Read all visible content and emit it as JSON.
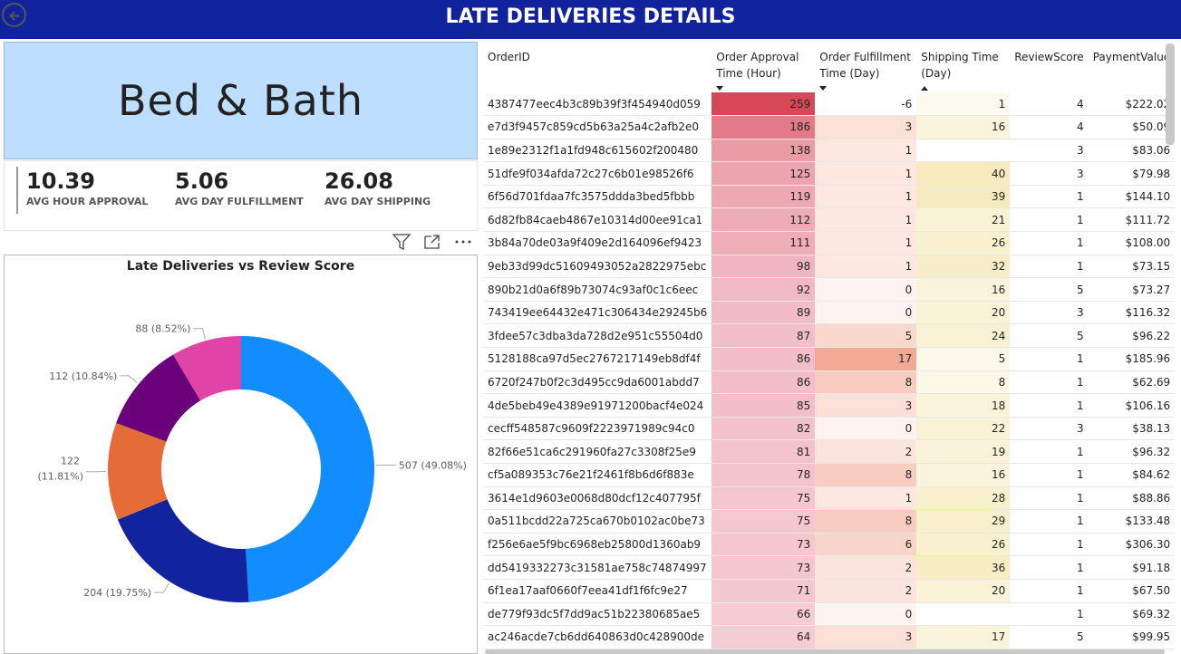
{
  "header": {
    "title": "LATE DELIVERIES DETAILS"
  },
  "category": {
    "name": "Bed & Bath",
    "color": "#bddefe"
  },
  "kpis": [
    {
      "value": "10.39",
      "label": "AVG HOUR APPROVAL"
    },
    {
      "value": "5.06",
      "label": "AVG DAY FULFILLMENT"
    },
    {
      "value": "26.08",
      "label": "AVG DAY SHIPPING"
    }
  ],
  "icons": [
    "filter-icon",
    "focus-mode-icon",
    "more-options-icon"
  ],
  "chart_data": {
    "type": "pie",
    "title": "Late Deliveries vs Review Score",
    "slices": [
      {
        "value": 507,
        "percent": 49.08,
        "label": "507 (49.08%)",
        "color": "#118dff"
      },
      {
        "value": 204,
        "percent": 19.75,
        "label": "204 (19.75%)",
        "color": "#12239e"
      },
      {
        "value": 122,
        "percent": 11.81,
        "label_line1": "122",
        "label_line2": "(11.81%)",
        "color": "#e66c37"
      },
      {
        "value": 112,
        "percent": 10.84,
        "label": "112 (10.84%)",
        "color": "#6b007b"
      },
      {
        "value": 88,
        "percent": 8.52,
        "label": "88 (8.52%)",
        "color": "#e044a7"
      }
    ]
  },
  "table": {
    "columns": [
      {
        "label": "OrderID",
        "sort": ""
      },
      {
        "label": "Order Approval Time (Hour)",
        "sort": "down"
      },
      {
        "label": "Order Fulfillment Time (Day)",
        "sort": "down"
      },
      {
        "label": "Shipping Time (Day)",
        "sort": "up"
      },
      {
        "label": "ReviewScore",
        "sort": ""
      },
      {
        "label": "PaymentValue",
        "sort": ""
      }
    ],
    "rows": [
      [
        "4387477eec4b3c89b39f3f454940d059",
        "259",
        "-6",
        "1",
        "4",
        "$222.02"
      ],
      [
        "e7d3f9457c859cd5b63a25a4c2afb2e0",
        "186",
        "3",
        "16",
        "4",
        "$50.09"
      ],
      [
        "1e89e2312f1a1fd948c615602f200480",
        "138",
        "1",
        "",
        "3",
        "$83.06"
      ],
      [
        "51dfe9f034afda72c27c6b01e98526f6",
        "125",
        "1",
        "40",
        "3",
        "$79.98"
      ],
      [
        "6f56d701fdaa7fc3575ddda3bed5fbbb",
        "119",
        "1",
        "39",
        "1",
        "$144.10"
      ],
      [
        "6d82fb84caeb4867e10314d00ee91ca1",
        "112",
        "1",
        "21",
        "1",
        "$111.72"
      ],
      [
        "3b84a70de03a9f409e2d164096ef9423",
        "111",
        "1",
        "26",
        "1",
        "$108.00"
      ],
      [
        "9eb33d99dc51609493052a2822975ebc",
        "98",
        "1",
        "32",
        "1",
        "$73.15"
      ],
      [
        "890b21d0a6f89b73074c93af0c1c6eec",
        "92",
        "0",
        "16",
        "5",
        "$73.27"
      ],
      [
        "743419ee64432e471c306434e29245b6",
        "89",
        "0",
        "20",
        "3",
        "$116.32"
      ],
      [
        "3fdee57c3dba3da728d2e951c55504d0",
        "87",
        "5",
        "24",
        "5",
        "$96.22"
      ],
      [
        "5128188ca97d5ec2767217149eb8df4f",
        "86",
        "17",
        "5",
        "1",
        "$185.96"
      ],
      [
        "6720f247b0f2c3d495cc9da6001abdd7",
        "86",
        "8",
        "8",
        "1",
        "$62.69"
      ],
      [
        "4de5beb49e4389e91971200bacf4e024",
        "85",
        "3",
        "18",
        "1",
        "$106.16"
      ],
      [
        "cecff548587c9609f2223971989c94c0",
        "82",
        "0",
        "22",
        "3",
        "$38.13"
      ],
      [
        "82f66e51ca6c291960fa27c3308f25e9",
        "81",
        "2",
        "19",
        "1",
        "$96.32"
      ],
      [
        "cf5a089353c76e21f2461f8b6d6f883e",
        "78",
        "8",
        "16",
        "1",
        "$84.62"
      ],
      [
        "3614e1d9603e0068d80dcf12c407795f",
        "75",
        "1",
        "28",
        "1",
        "$88.86"
      ],
      [
        "0a511bcdd22a725ca670b0102ac0be73",
        "75",
        "8",
        "29",
        "1",
        "$133.48"
      ],
      [
        "f256e6ae5f9bc6968eb25800d1360ab9",
        "73",
        "6",
        "26",
        "1",
        "$306.30"
      ],
      [
        "dd5419332273c31581ae758c74874997",
        "73",
        "2",
        "36",
        "1",
        "$91.18"
      ],
      [
        "6f1ea17aaf0660f7eea41df1f6fc9e27",
        "71",
        "2",
        "20",
        "1",
        "$67.50"
      ],
      [
        "de779f93dc5f7dd9ac51b22380685ae5",
        "66",
        "0",
        "",
        "1",
        "$69.32"
      ],
      [
        "ac246acde7cb6dd640863d0c428900de",
        "64",
        "3",
        "17",
        "5",
        "$99.95"
      ]
    ]
  }
}
